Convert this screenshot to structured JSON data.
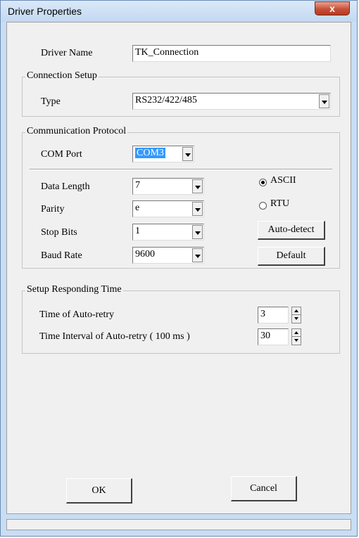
{
  "window": {
    "title": "Driver Properties",
    "close_glyph": "x"
  },
  "driver_name": {
    "label": "Driver Name",
    "value": "TK_Connection"
  },
  "connection_setup": {
    "group_label": "Connection Setup",
    "type_label": "Type",
    "type_value": "RS232/422/485"
  },
  "communication_protocol": {
    "group_label": "Communication Protocol",
    "com_port_label": "COM Port",
    "com_port_value": "COM3",
    "data_length_label": "Data Length",
    "data_length_value": "7",
    "parity_label": "Parity",
    "parity_value": "e",
    "stop_bits_label": "Stop Bits",
    "stop_bits_value": "1",
    "baud_rate_label": "Baud Rate",
    "baud_rate_value": "9600",
    "mode_ascii_label": "ASCII",
    "mode_rtu_label": "RTU",
    "mode_selected": "ASCII",
    "auto_detect_label": "Auto-detect",
    "default_label": "Default"
  },
  "responding_time": {
    "group_label": "Setup Responding Time",
    "auto_retry_label": "Time of Auto-retry",
    "auto_retry_value": "3",
    "interval_label": "Time Interval of Auto-retry ( 100 ms )",
    "interval_value": "30"
  },
  "footer": {
    "ok_label": "OK",
    "cancel_label": "Cancel"
  },
  "colors": {
    "title_bar": "#c2d8f1",
    "close": "#c7503a",
    "selection": "#3399ff",
    "panel": "#f0f0f0"
  }
}
